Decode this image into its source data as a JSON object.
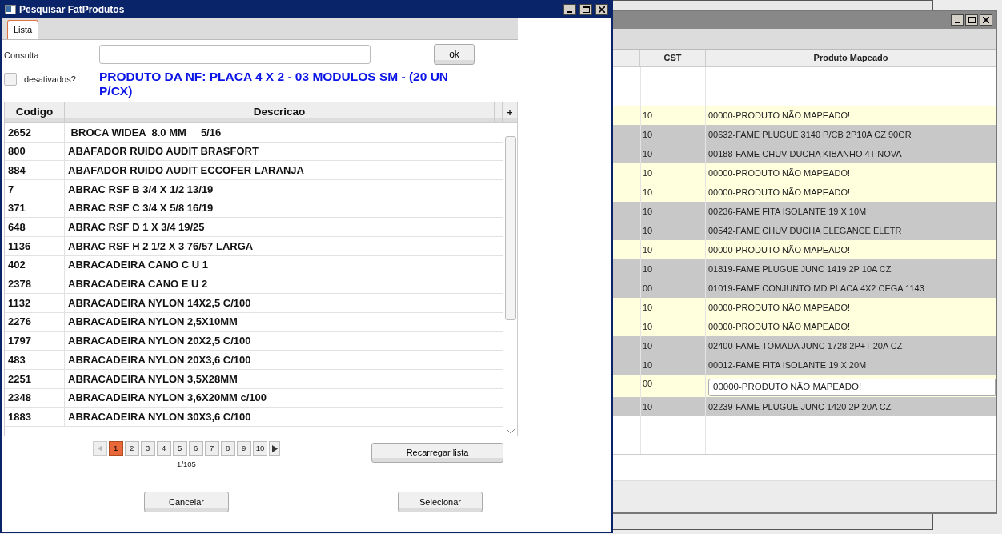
{
  "back_window": {
    "columns": [
      "CST",
      "Produto Mapeado"
    ],
    "rows": [
      {
        "cst": "10",
        "produto": "00000-PRODUTO NÃO MAPEADO!",
        "mapped": false,
        "editing": false
      },
      {
        "cst": "10",
        "produto": "00632-FAME PLUGUE 3140 P/CB 2P10A CZ 90GR",
        "mapped": true,
        "editing": false
      },
      {
        "cst": "10",
        "produto": "00188-FAME CHUV DUCHA KIBANHO 4T NOVA",
        "mapped": true,
        "editing": false
      },
      {
        "cst": "10",
        "produto": "00000-PRODUTO NÃO MAPEADO!",
        "mapped": false,
        "editing": false
      },
      {
        "cst": "10",
        "produto": "00000-PRODUTO NÃO MAPEADO!",
        "mapped": false,
        "editing": false
      },
      {
        "cst": "10",
        "produto": "00236-FAME FITA ISOLANTE 19 X 10M",
        "mapped": true,
        "editing": false
      },
      {
        "cst": "10",
        "produto": "00542-FAME CHUV DUCHA ELEGANCE ELETR",
        "mapped": true,
        "editing": false
      },
      {
        "cst": "10",
        "produto": "00000-PRODUTO NÃO MAPEADO!",
        "mapped": false,
        "editing": false
      },
      {
        "cst": "10",
        "produto": "01819-FAME PLUGUE JUNC 1419 2P 10A CZ",
        "mapped": true,
        "editing": false
      },
      {
        "cst": "00",
        "produto": "01019-FAME CONJUNTO MD PLACA 4X2 CEGA 1143",
        "mapped": true,
        "editing": false
      },
      {
        "cst": "10",
        "produto": "00000-PRODUTO NÃO MAPEADO!",
        "mapped": false,
        "editing": false
      },
      {
        "cst": "10",
        "produto": "00000-PRODUTO NÃO MAPEADO!",
        "mapped": false,
        "editing": false
      },
      {
        "cst": "10",
        "produto": "02400-FAME TOMADA JUNC 1728 2P+T 20A CZ",
        "mapped": true,
        "editing": false
      },
      {
        "cst": "10",
        "produto": "00012-FAME FITA ISOLANTE 19 X 20M",
        "mapped": true,
        "editing": false
      },
      {
        "cst": "00",
        "produto": "00000-PRODUTO NÃO MAPEADO!",
        "mapped": false,
        "editing": true
      },
      {
        "cst": "10",
        "produto": "02239-FAME PLUGUE JUNC 1420 2P 20A CZ",
        "mapped": true,
        "editing": false
      }
    ]
  },
  "dialog": {
    "title": "Pesquisar FatProdutos",
    "tabs": [
      {
        "label": "Lista",
        "selected": true
      }
    ],
    "consulta_label": "Consulta",
    "ok_button": "ok",
    "desativados": {
      "label": "desativados?",
      "checked": false
    },
    "produto_nf": "PRODUTO DA NF: PLACA 4 X 2 - 03 MODULOS SM  - (20 UN P/CX)",
    "columns": [
      "Codigo",
      "Descricao"
    ],
    "add_column": "+",
    "rows": [
      {
        "codigo": "2652",
        "descricao": " BROCA WIDEA  8.0 MM     5/16"
      },
      {
        "codigo": "800",
        "descricao": "ABAFADOR RUIDO AUDIT BRASFORT"
      },
      {
        "codigo": "884",
        "descricao": "ABAFADOR RUIDO AUDIT ECCOFER LARANJA"
      },
      {
        "codigo": "7",
        "descricao": "ABRAC RSF B 3/4 X 1/2 13/19"
      },
      {
        "codigo": "371",
        "descricao": "ABRAC RSF C 3/4 X 5/8 16/19"
      },
      {
        "codigo": "648",
        "descricao": "ABRAC RSF D 1 X 3/4 19/25"
      },
      {
        "codigo": "1136",
        "descricao": "ABRAC RSF H 2 1/2 X 3 76/57 LARGA"
      },
      {
        "codigo": "402",
        "descricao": "ABRACADEIRA CANO C U 1"
      },
      {
        "codigo": "2378",
        "descricao": "ABRACADEIRA CANO E U 2"
      },
      {
        "codigo": "1132",
        "descricao": "ABRACADEIRA NYLON 14X2,5 C/100"
      },
      {
        "codigo": "2276",
        "descricao": "ABRACADEIRA NYLON 2,5X10MM"
      },
      {
        "codigo": "1797",
        "descricao": "ABRACADEIRA NYLON 20X2,5 C/100"
      },
      {
        "codigo": "483",
        "descricao": "ABRACADEIRA NYLON 20X3,6 C/100"
      },
      {
        "codigo": "2251",
        "descricao": "ABRACADEIRA NYLON 3,5X28MM"
      },
      {
        "codigo": "2348",
        "descricao": "ABRACADEIRA NYLON 3,6X20MM c/100"
      },
      {
        "codigo": "1883",
        "descricao": "ABRACADEIRA NYLON 30X3,6 C/100"
      }
    ],
    "pages": [
      {
        "label": "1",
        "selected": true
      },
      {
        "label": "2",
        "selected": false
      },
      {
        "label": "3",
        "selected": false
      },
      {
        "label": "4",
        "selected": false
      },
      {
        "label": "5",
        "selected": false
      },
      {
        "label": "6",
        "selected": false
      },
      {
        "label": "7",
        "selected": false
      },
      {
        "label": "8",
        "selected": false
      },
      {
        "label": "9",
        "selected": false
      },
      {
        "label": "10",
        "selected": false
      }
    ],
    "page_count": "1/105",
    "reload_button": "Recarregar lista",
    "cancel_button": "Cancelar",
    "select_button": "Selecionar"
  }
}
